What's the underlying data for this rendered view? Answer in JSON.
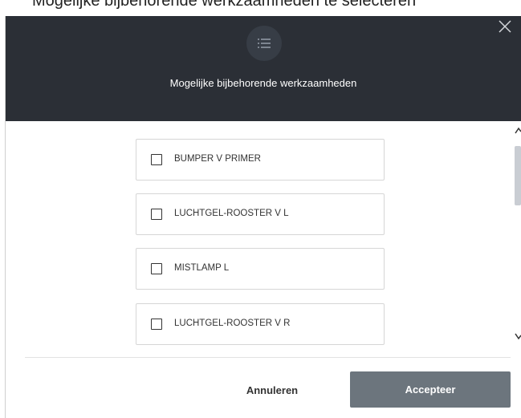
{
  "background_text": "Mogelijke bijbehorende werkzaamheden te selecteren",
  "dialog": {
    "title": "Mogelijke bijbehorende werkzaamheden",
    "header_icon": "list-icon",
    "close_icon": "close-icon",
    "header_color": "#2b2f36"
  },
  "options": [
    {
      "label": "BUMPER V PRIMER",
      "checked": false
    },
    {
      "label": "LUCHTGEL-ROOSTER V L",
      "checked": false
    },
    {
      "label": "MISTLAMP L",
      "checked": false
    },
    {
      "label": "LUCHTGEL-ROOSTER V R",
      "checked": false
    }
  ],
  "footer": {
    "cancel_label": "Annuleren",
    "accept_label": "Accepteer",
    "accept_color": "#6c757d"
  }
}
